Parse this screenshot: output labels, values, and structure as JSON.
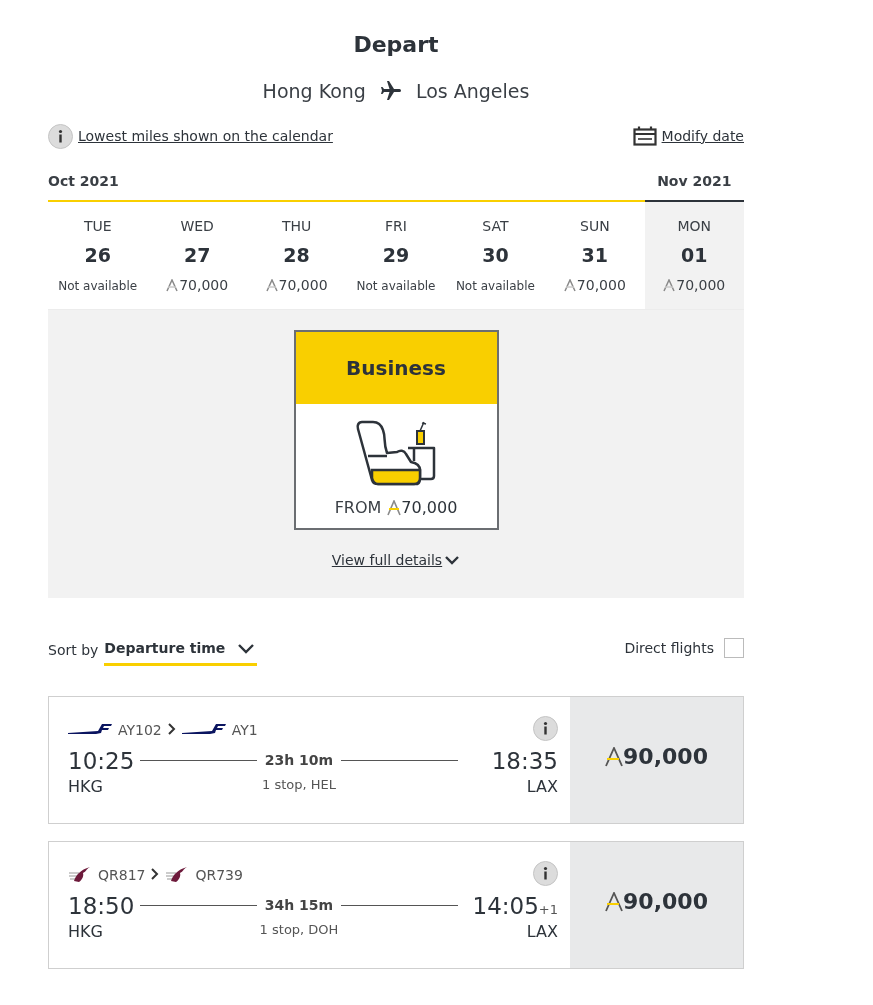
{
  "title": "Depart",
  "route": {
    "origin": "Hong Kong",
    "destination": "Los Angeles"
  },
  "info_link": "Lowest miles shown on the calendar",
  "modify_link": "Modify date",
  "months": [
    {
      "label": "Oct 2021",
      "days": [
        {
          "weekday": "TUE",
          "date": "26",
          "kind": "unavailable",
          "price": "Not available",
          "selected": false
        },
        {
          "weekday": "WED",
          "date": "27",
          "kind": "price",
          "price": "70,000",
          "selected": false
        },
        {
          "weekday": "THU",
          "date": "28",
          "kind": "price",
          "price": "70,000",
          "selected": false
        },
        {
          "weekday": "FRI",
          "date": "29",
          "kind": "unavailable",
          "price": "Not available",
          "selected": false
        },
        {
          "weekday": "SAT",
          "date": "30",
          "kind": "unavailable",
          "price": "Not available",
          "selected": false
        },
        {
          "weekday": "SUN",
          "date": "31",
          "kind": "price",
          "price": "70,000",
          "selected": false
        }
      ]
    },
    {
      "label": "Nov 2021",
      "days": [
        {
          "weekday": "MON",
          "date": "01",
          "kind": "price",
          "price": "70,000",
          "selected": true
        }
      ]
    }
  ],
  "cabin": {
    "name": "Business",
    "from_label": "FROM",
    "price": "70,000"
  },
  "details_link": "View full details",
  "sort": {
    "label": "Sort by",
    "value": "Departure time"
  },
  "direct_flights": {
    "label": "Direct flights",
    "checked": false
  },
  "flights": [
    {
      "legs": [
        {
          "kind": "swoosh",
          "code": "AY102"
        },
        {
          "kind": "swoosh",
          "code": "AY1"
        }
      ],
      "depart_time": "10:25",
      "depart_airport": "HKG",
      "duration": "23h 10m",
      "stops": "1 stop, HEL",
      "arrive_time": "18:35",
      "arrive_airport": "LAX",
      "price": "90,000"
    },
    {
      "legs": [
        {
          "kind": "bird",
          "code": "QR817"
        },
        {
          "kind": "bird",
          "code": "QR739"
        }
      ],
      "depart_time": "18:50",
      "depart_airport": "HKG",
      "duration": "34h 15m",
      "stops": "1 stop, DOH",
      "arrive_time": "14:05",
      "day_offset": "+1",
      "arrive_airport": "LAX",
      "price": "90,000"
    }
  ]
}
